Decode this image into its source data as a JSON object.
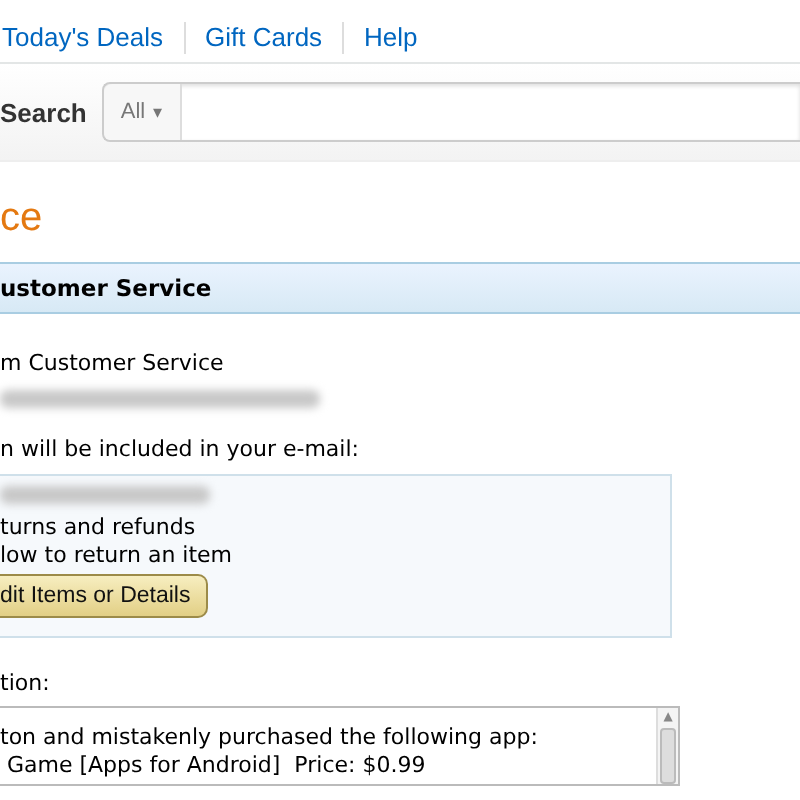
{
  "nav": {
    "links": [
      "Today's Deals",
      "Gift Cards",
      "Help"
    ]
  },
  "search": {
    "label": "Search",
    "category": "All",
    "caret": "▾"
  },
  "page_title": "ce",
  "panel": {
    "heading": "ustomer Service",
    "from_line": "m Customer Service",
    "info_label": "n will be included in your e-mail:",
    "info_lines": [
      "turns and refunds",
      "low to return an item"
    ],
    "edit_button": "dit Items or Details",
    "message_label": "tion:",
    "message_lines": [
      "ton and mistakenly purchased the following app:",
      " Game [Apps for Android]  Price: $0.99"
    ],
    "scroll_up": "▲"
  }
}
